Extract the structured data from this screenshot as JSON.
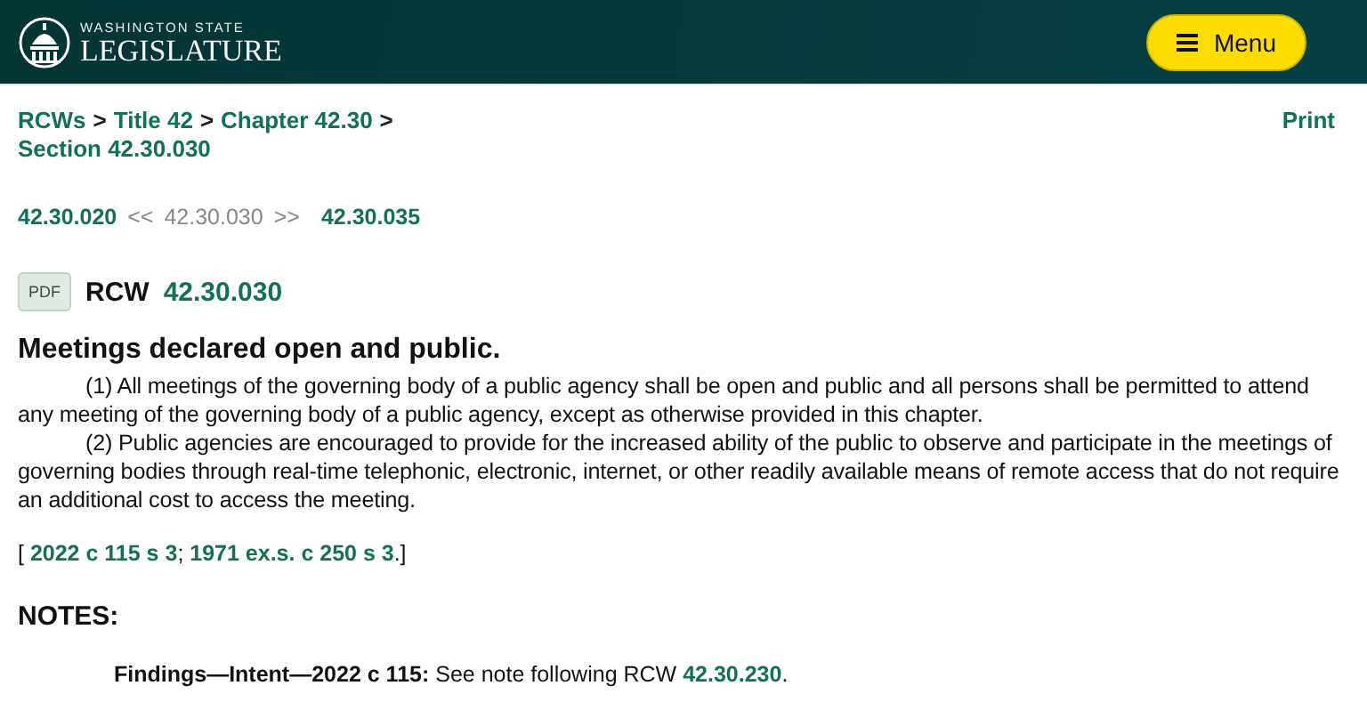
{
  "header": {
    "logo_top": "WASHINGTON STATE",
    "logo_bottom": "LEGISLATURE",
    "menu_label": "Menu"
  },
  "breadcrumb": [
    {
      "kind": "link",
      "text": "RCWs"
    },
    {
      "kind": "separator",
      "text": ">"
    },
    {
      "kind": "link",
      "text": "Title 42"
    },
    {
      "kind": "separator",
      "text": ">"
    },
    {
      "kind": "link",
      "text": "Chapter 42.30"
    },
    {
      "kind": "separator",
      "text": ">"
    },
    {
      "kind": "link",
      "text": "Section 42.30.030"
    }
  ],
  "print": "Print",
  "section_nav": {
    "previous": "42.30.020",
    "back_arrows": "<<",
    "current": "42.30.030",
    "forward_arrows": ">>",
    "next": "42.30.035"
  },
  "pdf_label": "PDF",
  "rcw_label": "RCW",
  "rcw_number": "42.30.030",
  "heading": "Meetings declared open and public.",
  "paragraphs": [
    "(1) All meetings of the governing body of a public agency shall be open and public and all persons shall be permitted to attend any meeting of the governing body of a public agency, except as otherwise provided in this chapter.",
    "(2) Public agencies are encouraged to provide for the increased ability of the public to observe and participate in the meetings of governing bodies through real-time telephonic, electronic, internet, or other readily available means of remote access that do not require an additional cost to access the meeting."
  ],
  "citation": [
    {
      "kind": "text",
      "text": "[ "
    },
    {
      "kind": "link",
      "text": "2022 c 115 s 3"
    },
    {
      "kind": "text",
      "text": "; "
    },
    {
      "kind": "link",
      "text": "1971 ex.s. c 250 s 3"
    },
    {
      "kind": "text",
      "text": ".]"
    }
  ],
  "notes_heading": "NOTES:",
  "note": [
    {
      "kind": "bold",
      "text": "Findings—Intent—2022 c 115:"
    },
    {
      "kind": "text",
      "text": " See note following RCW "
    },
    {
      "kind": "link",
      "text": "42.30.230"
    },
    {
      "kind": "text",
      "text": "."
    }
  ]
}
